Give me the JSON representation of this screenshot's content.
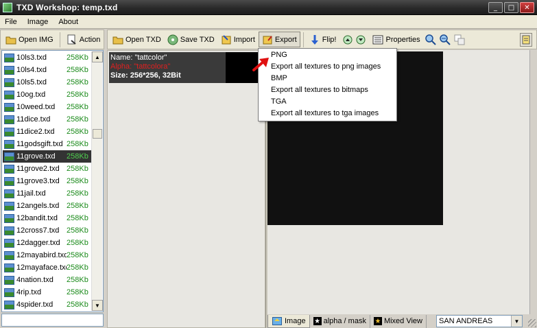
{
  "window": {
    "title": "TXD Workshop: temp.txd",
    "controls": [
      "_",
      "□",
      "✕"
    ]
  },
  "menu": [
    "File",
    "Image",
    "About"
  ],
  "toolbar_left": {
    "open_img": "Open IMG",
    "action": "Action"
  },
  "toolbar_right": {
    "open_txd": "Open TXD",
    "save_txd": "Save TXD",
    "import": "Import",
    "export": "Export",
    "flip": "Flip!",
    "properties": "Properties"
  },
  "file_list": [
    {
      "name": "10ls3.txd",
      "size": "258Kb"
    },
    {
      "name": "10ls4.txd",
      "size": "258Kb"
    },
    {
      "name": "10ls5.txd",
      "size": "258Kb"
    },
    {
      "name": "10og.txd",
      "size": "258Kb"
    },
    {
      "name": "10weed.txd",
      "size": "258Kb"
    },
    {
      "name": "11dice.txd",
      "size": "258Kb"
    },
    {
      "name": "11dice2.txd",
      "size": "258Kb"
    },
    {
      "name": "11godsgift.txd",
      "size": "258Kb"
    },
    {
      "name": "11grove.txd",
      "size": "258Kb",
      "selected": true
    },
    {
      "name": "11grove2.txd",
      "size": "258Kb"
    },
    {
      "name": "11grove3.txd",
      "size": "258Kb"
    },
    {
      "name": "11jail.txd",
      "size": "258Kb"
    },
    {
      "name": "12angels.txd",
      "size": "258Kb"
    },
    {
      "name": "12bandit.txd",
      "size": "258Kb"
    },
    {
      "name": "12cross7.txd",
      "size": "258Kb"
    },
    {
      "name": "12dagger.txd",
      "size": "258Kb"
    },
    {
      "name": "12mayabird.txd",
      "size": "258Kb"
    },
    {
      "name": "12mayaface.txd",
      "size": "258Kb"
    },
    {
      "name": "4nation.txd",
      "size": "258Kb"
    },
    {
      "name": "4rip.txd",
      "size": "258Kb"
    },
    {
      "name": "4spider.txd",
      "size": "258Kb"
    }
  ],
  "texture": {
    "name": "Name: \"tattcolor\"",
    "alpha": "Alpha: \"tattcolora\"",
    "size": "Size: 256*256, 32Bit"
  },
  "export_menu": [
    "PNG",
    "Export all textures to png images",
    "BMP",
    "Export all textures to bitmaps",
    "TGA",
    "Export all textures to tga images"
  ],
  "tabs": {
    "image": "Image",
    "alpha": "alpha / mask",
    "mixed": "Mixed View"
  },
  "game_select": {
    "value": "SAN ANDREAS"
  },
  "colors": {
    "selected_row": "#333333",
    "size_text": "#1a8a1a",
    "alpha_text": "#e02020"
  }
}
